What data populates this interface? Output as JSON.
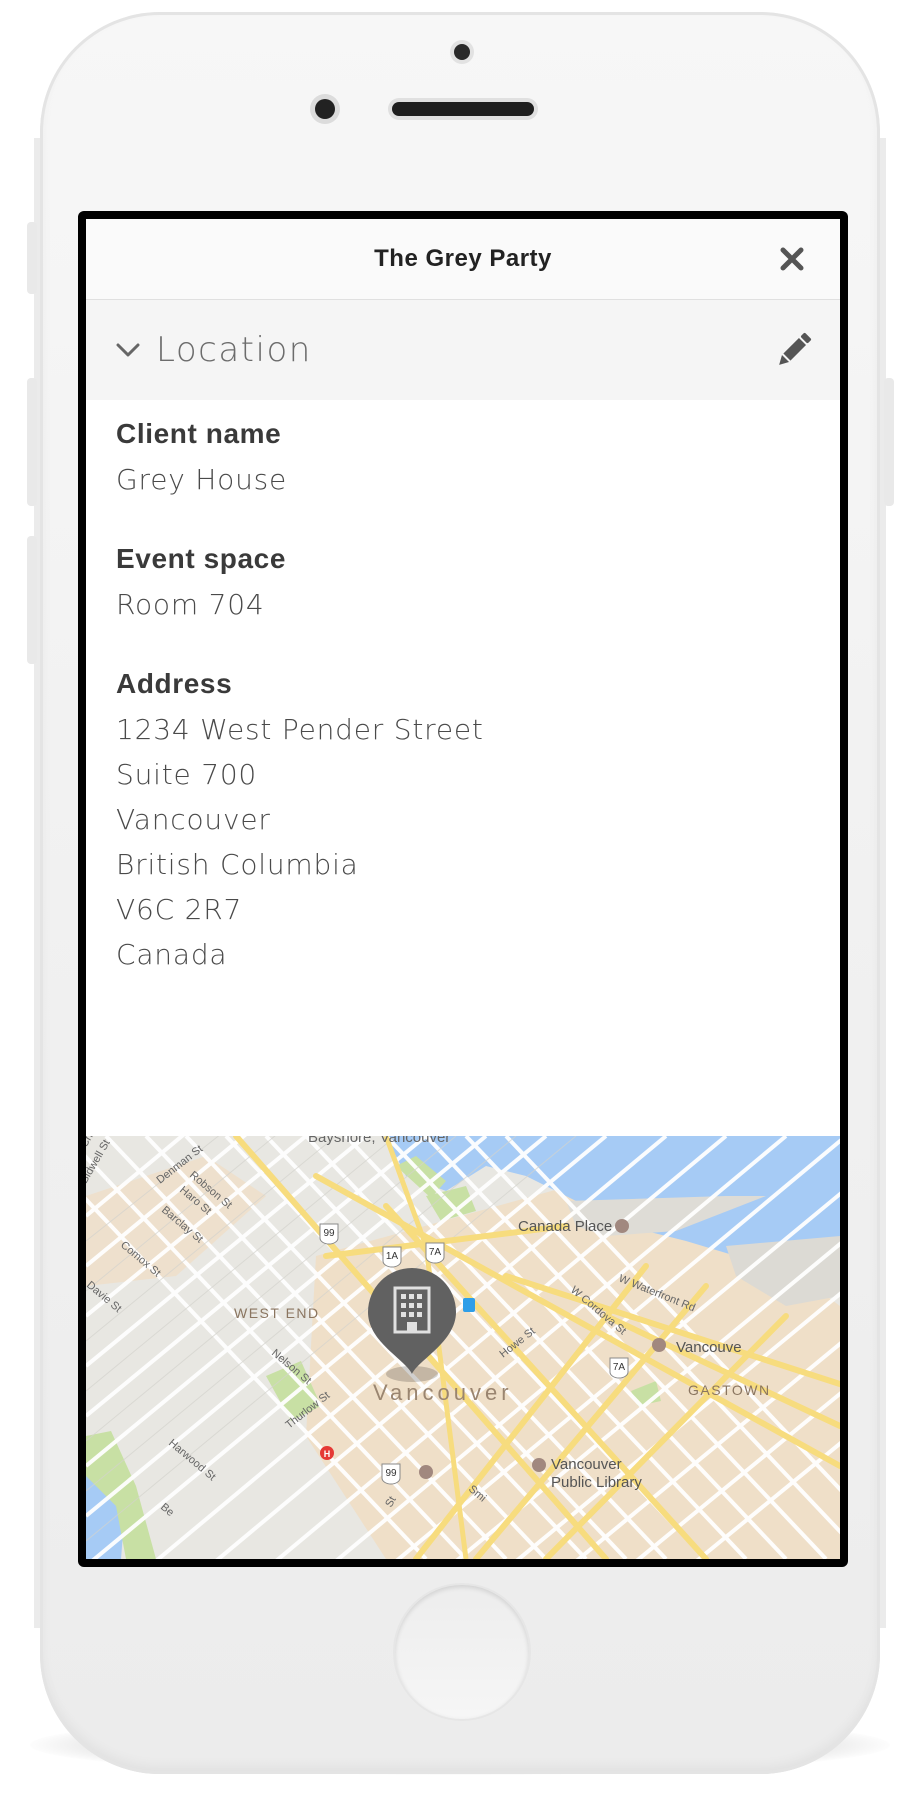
{
  "header": {
    "title": "The Grey Party"
  },
  "section": {
    "title": "Location"
  },
  "details": {
    "client_name_label": "Client name",
    "client_name": "Grey House",
    "event_space_label": "Event space",
    "event_space": "Room 704",
    "address_label": "Address",
    "address_lines": [
      "1234 West Pender Street",
      "Suite 700",
      "Vancouver",
      "British Columbia",
      "V6C 2R7",
      "Canada"
    ]
  },
  "map": {
    "labels": {
      "bayshore": "Bayshore, Vancouver",
      "canada_place": "Canada Place",
      "west_end": "WEST END",
      "vancouver": "Vancouver",
      "vancouver_lookout": "Vancouve",
      "gastown": "GASTOWN",
      "library_1": "Vancouver",
      "library_2": "Public Library",
      "denman": "Denman St",
      "robson": "Robson St",
      "haro": "Haro St",
      "barclay": "Barclay St",
      "comox": "Comox St",
      "davie": "Davie St",
      "nelson": "Nelson St",
      "thurlow": "Thurlow St",
      "harwood": "Harwood St",
      "howe": "Howe St",
      "cordova": "W Cordova St",
      "waterfront": "W Waterfront Rd",
      "bidwell": "Bidwell St",
      "chilco": "Chilco",
      "smithe": "Smi",
      "seymour": "St",
      "bute": "Be"
    },
    "shields": [
      "99",
      "1A",
      "7A",
      "7A",
      "99"
    ]
  },
  "colors": {
    "map_water": "#a6cbf5",
    "map_park": "#c8e0a4",
    "map_land": "#e8e7e2",
    "map_road_major": "#f7dc7e",
    "map_downtown": "#f2dcbf",
    "pin": "#616161"
  },
  "icons": {
    "close": "close-icon",
    "chevron": "chevron-down-icon",
    "edit": "pencil-icon",
    "pin": "building-pin-icon"
  }
}
